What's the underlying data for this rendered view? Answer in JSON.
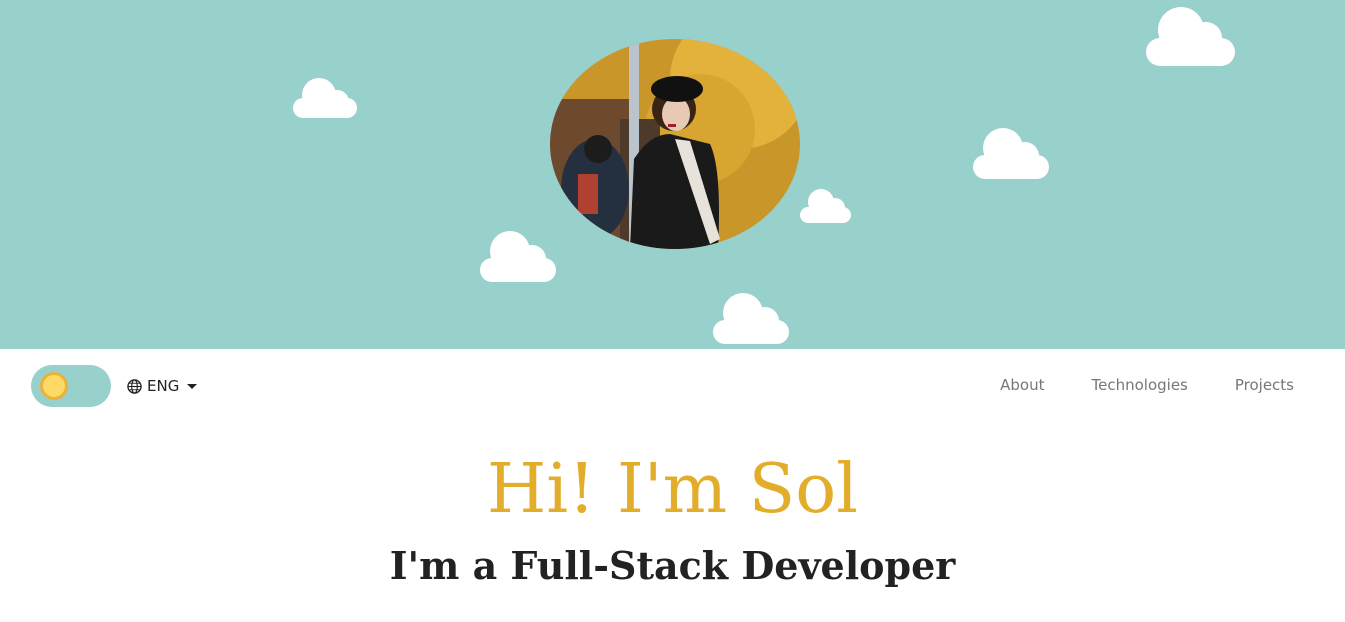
{
  "theme": {
    "hero_bg": "#98d0cb",
    "accent": "#e3ad2c",
    "sun": "#ffd966"
  },
  "hero": {
    "avatar_alt": "profile-photo"
  },
  "navbar": {
    "theme_toggle_state": "light",
    "language": {
      "icon": "globe-icon",
      "label": "ENG"
    },
    "links": [
      "About",
      "Technologies",
      "Projects"
    ]
  },
  "main": {
    "greeting": "Hi! I'm Sol",
    "role": "I'm a Full-Stack Developer"
  }
}
